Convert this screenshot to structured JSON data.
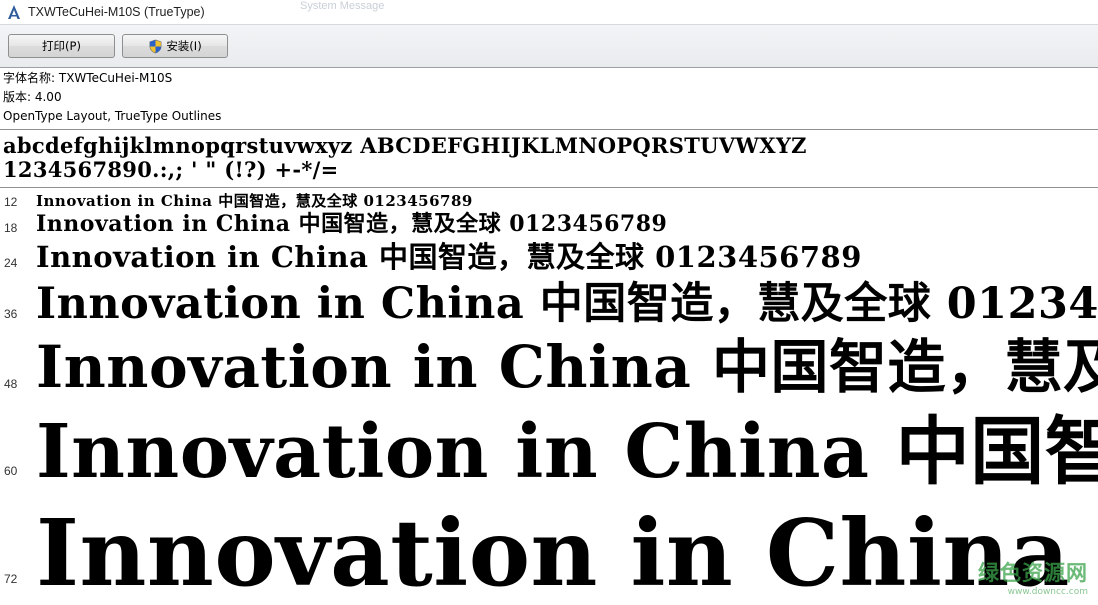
{
  "window": {
    "title": "TXWTeCuHei-M10S (TrueType)",
    "ghost_text": "System Message"
  },
  "toolbar": {
    "print_label": "打印(P)",
    "install_label": "安装(I)"
  },
  "info": {
    "font_name_line": "字体名称: TXWTeCuHei-M10S",
    "version_line": "版本: 4.00",
    "type_line": "OpenType Layout, TrueType Outlines"
  },
  "charset": {
    "line1": "abcdefghijklmnopqrstuvwxyz ABCDEFGHIJKLMNOPQRSTUVWXYZ",
    "line2": "1234567890.:,; ' \" (!?) +-*/="
  },
  "samples": {
    "text": "Innovation in China 中国智造，慧及全球 0123456789",
    "rows": [
      {
        "size": "12"
      },
      {
        "size": "18"
      },
      {
        "size": "24"
      },
      {
        "size": "36"
      },
      {
        "size": "48"
      },
      {
        "size": "60"
      },
      {
        "size": "72"
      }
    ]
  },
  "watermark": {
    "main": "绿色资源网",
    "sub": "www.downcc.com"
  },
  "colors": {
    "toolbar_bg": "#e9ebee",
    "divider": "#909090",
    "watermark": "#3aa34a"
  }
}
